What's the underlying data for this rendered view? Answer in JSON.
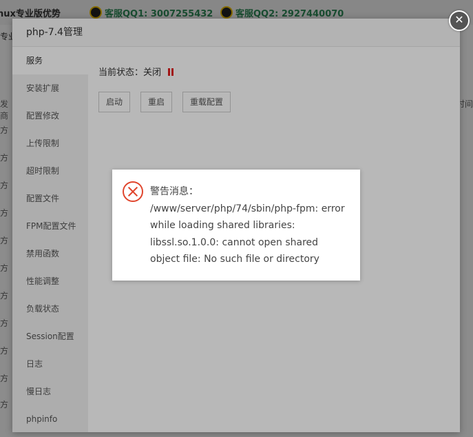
{
  "background": {
    "brand_partial": "nux专业版优势",
    "qq1": "客服QQ1: 3007255432",
    "qq2": "客服QQ2: 2927440070",
    "sub_partial": "专业",
    "col_left": "发商",
    "col_right": "时间",
    "row_label": "方"
  },
  "modal": {
    "title": "php-7.4管理",
    "close_glyph": "✕",
    "sidebar": [
      {
        "label": "服务"
      },
      {
        "label": "安装扩展"
      },
      {
        "label": "配置修改"
      },
      {
        "label": "上传限制"
      },
      {
        "label": "超时限制"
      },
      {
        "label": "配置文件"
      },
      {
        "label": "FPM配置文件"
      },
      {
        "label": "禁用函数"
      },
      {
        "label": "性能调整"
      },
      {
        "label": "负载状态"
      },
      {
        "label": "Session配置"
      },
      {
        "label": "日志"
      },
      {
        "label": "慢日志"
      },
      {
        "label": "phpinfo"
      }
    ],
    "status_label": "当前状态：",
    "status_value": "关闭",
    "buttons": {
      "start": "启动",
      "restart": "重启",
      "reload": "重载配置"
    }
  },
  "alert": {
    "title": "警告消息：",
    "message": "/www/server/php/74/sbin/php-fpm: error while loading shared libraries: libssl.so.1.0.0: cannot open shared object file: No such file or directory"
  }
}
